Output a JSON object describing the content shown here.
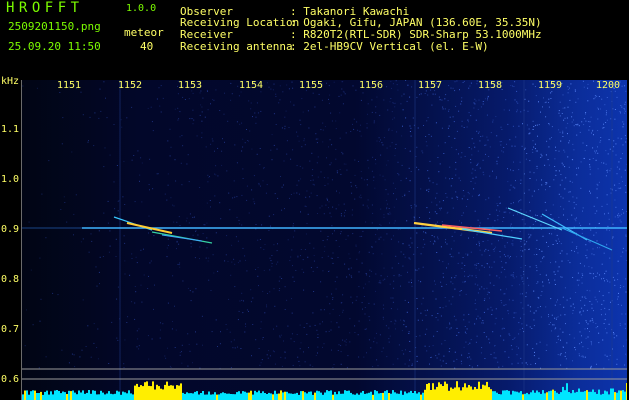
{
  "header": {
    "app_title": "HROFFT",
    "version": "1.0.0",
    "filename": "2509201150.png",
    "datetime": "25.09.20 11:50",
    "event_label": "meteor",
    "event_count": "40"
  },
  "info": [
    {
      "label": "Observer",
      "value": ": Takanori Kawachi"
    },
    {
      "label": "Receiving Location",
      "value": ": Ogaki, Gifu, JAPAN (136.60E, 35.35N)"
    },
    {
      "label": "Receiver",
      "value": ": R820T2(RTL-SDR) SDR-Sharp 53.1000MHz"
    },
    {
      "label": "Receiving antenna",
      "value": ": 2el-HB9CV Vertical (el. E-W)"
    }
  ],
  "axis": {
    "y_unit": "kHz",
    "y_ticks": [
      "1.1",
      "1.0",
      "0.9",
      "0.8",
      "0.7",
      "0.6"
    ],
    "x_ticks": [
      "1151",
      "1152",
      "1153",
      "1154",
      "1155",
      "1156",
      "1157",
      "1158",
      "1159",
      "1200"
    ]
  },
  "colors": {
    "header_green": "#7cfc00",
    "header_yellow": "#ffff66",
    "carrier": "#3fb3ff",
    "level_bar": "#00e5ff",
    "level_peak": "#ffee00"
  }
}
